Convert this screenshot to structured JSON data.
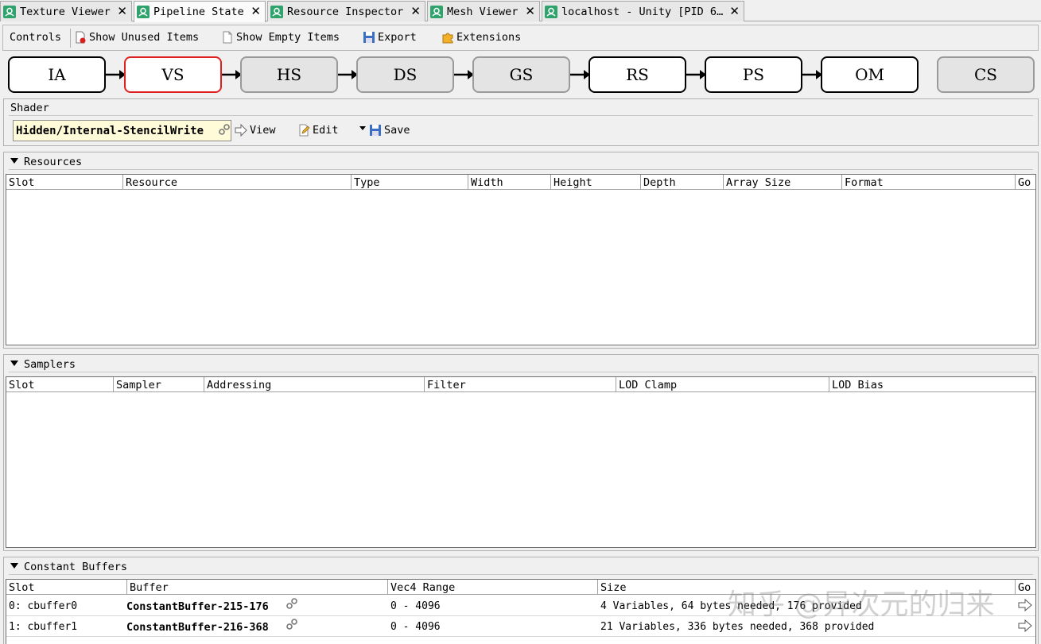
{
  "tabs": [
    {
      "label": "Texture Viewer",
      "icon": "renderdoc-icon"
    },
    {
      "label": "Pipeline State",
      "icon": "renderdoc-icon",
      "active": true
    },
    {
      "label": "Resource Inspector",
      "icon": "renderdoc-icon"
    },
    {
      "label": "Mesh Viewer",
      "icon": "renderdoc-icon"
    },
    {
      "label": "localhost - Unity [PID 6…",
      "icon": "renderdoc-icon"
    }
  ],
  "toolbar": {
    "controls_label": "Controls",
    "show_unused_label": "Show Unused Items",
    "show_empty_label": "Show Empty Items",
    "export_label": "Export",
    "extensions_label": "Extensions"
  },
  "stages": [
    {
      "label": "IA",
      "state": "active"
    },
    {
      "label": "VS",
      "state": "selected"
    },
    {
      "label": "HS",
      "state": "inactive"
    },
    {
      "label": "DS",
      "state": "inactive"
    },
    {
      "label": "GS",
      "state": "inactive"
    },
    {
      "label": "RS",
      "state": "active"
    },
    {
      "label": "PS",
      "state": "active"
    },
    {
      "label": "OM",
      "state": "active"
    },
    {
      "label": "CS",
      "state": "inactive"
    }
  ],
  "shader": {
    "group_title": "Shader",
    "name": "Hidden/Internal-StencilWrite",
    "view_label": "View",
    "edit_label": "Edit",
    "save_label": "Save"
  },
  "resources": {
    "title": "Resources",
    "columns": [
      "Slot",
      "Resource",
      "Type",
      "Width",
      "Height",
      "Depth",
      "Array Size",
      "Format",
      "Go"
    ]
  },
  "samplers": {
    "title": "Samplers",
    "columns": [
      "Slot",
      "Sampler",
      "Addressing",
      "Filter",
      "LOD Clamp",
      "LOD Bias"
    ]
  },
  "constant_buffers": {
    "title": "Constant Buffers",
    "columns": [
      "Slot",
      "Buffer",
      "Vec4 Range",
      "Size",
      "Go"
    ],
    "rows": [
      {
        "slot": "0: cbuffer0",
        "buffer": "ConstantBuffer-215-176",
        "range": "0 - 4096",
        "size": "4 Variables, 64 bytes needed, 176 provided"
      },
      {
        "slot": "1: cbuffer1",
        "buffer": "ConstantBuffer-216-368",
        "range": "0 - 4096",
        "size": "21 Variables, 336 bytes needed, 368 provided"
      }
    ]
  },
  "watermark": "知乎 @异次元的归来",
  "colors": {
    "selected_stage_border": "#e02020",
    "shader_field_bg": "#fffbd8",
    "tab_icon": "#2fa36b"
  }
}
